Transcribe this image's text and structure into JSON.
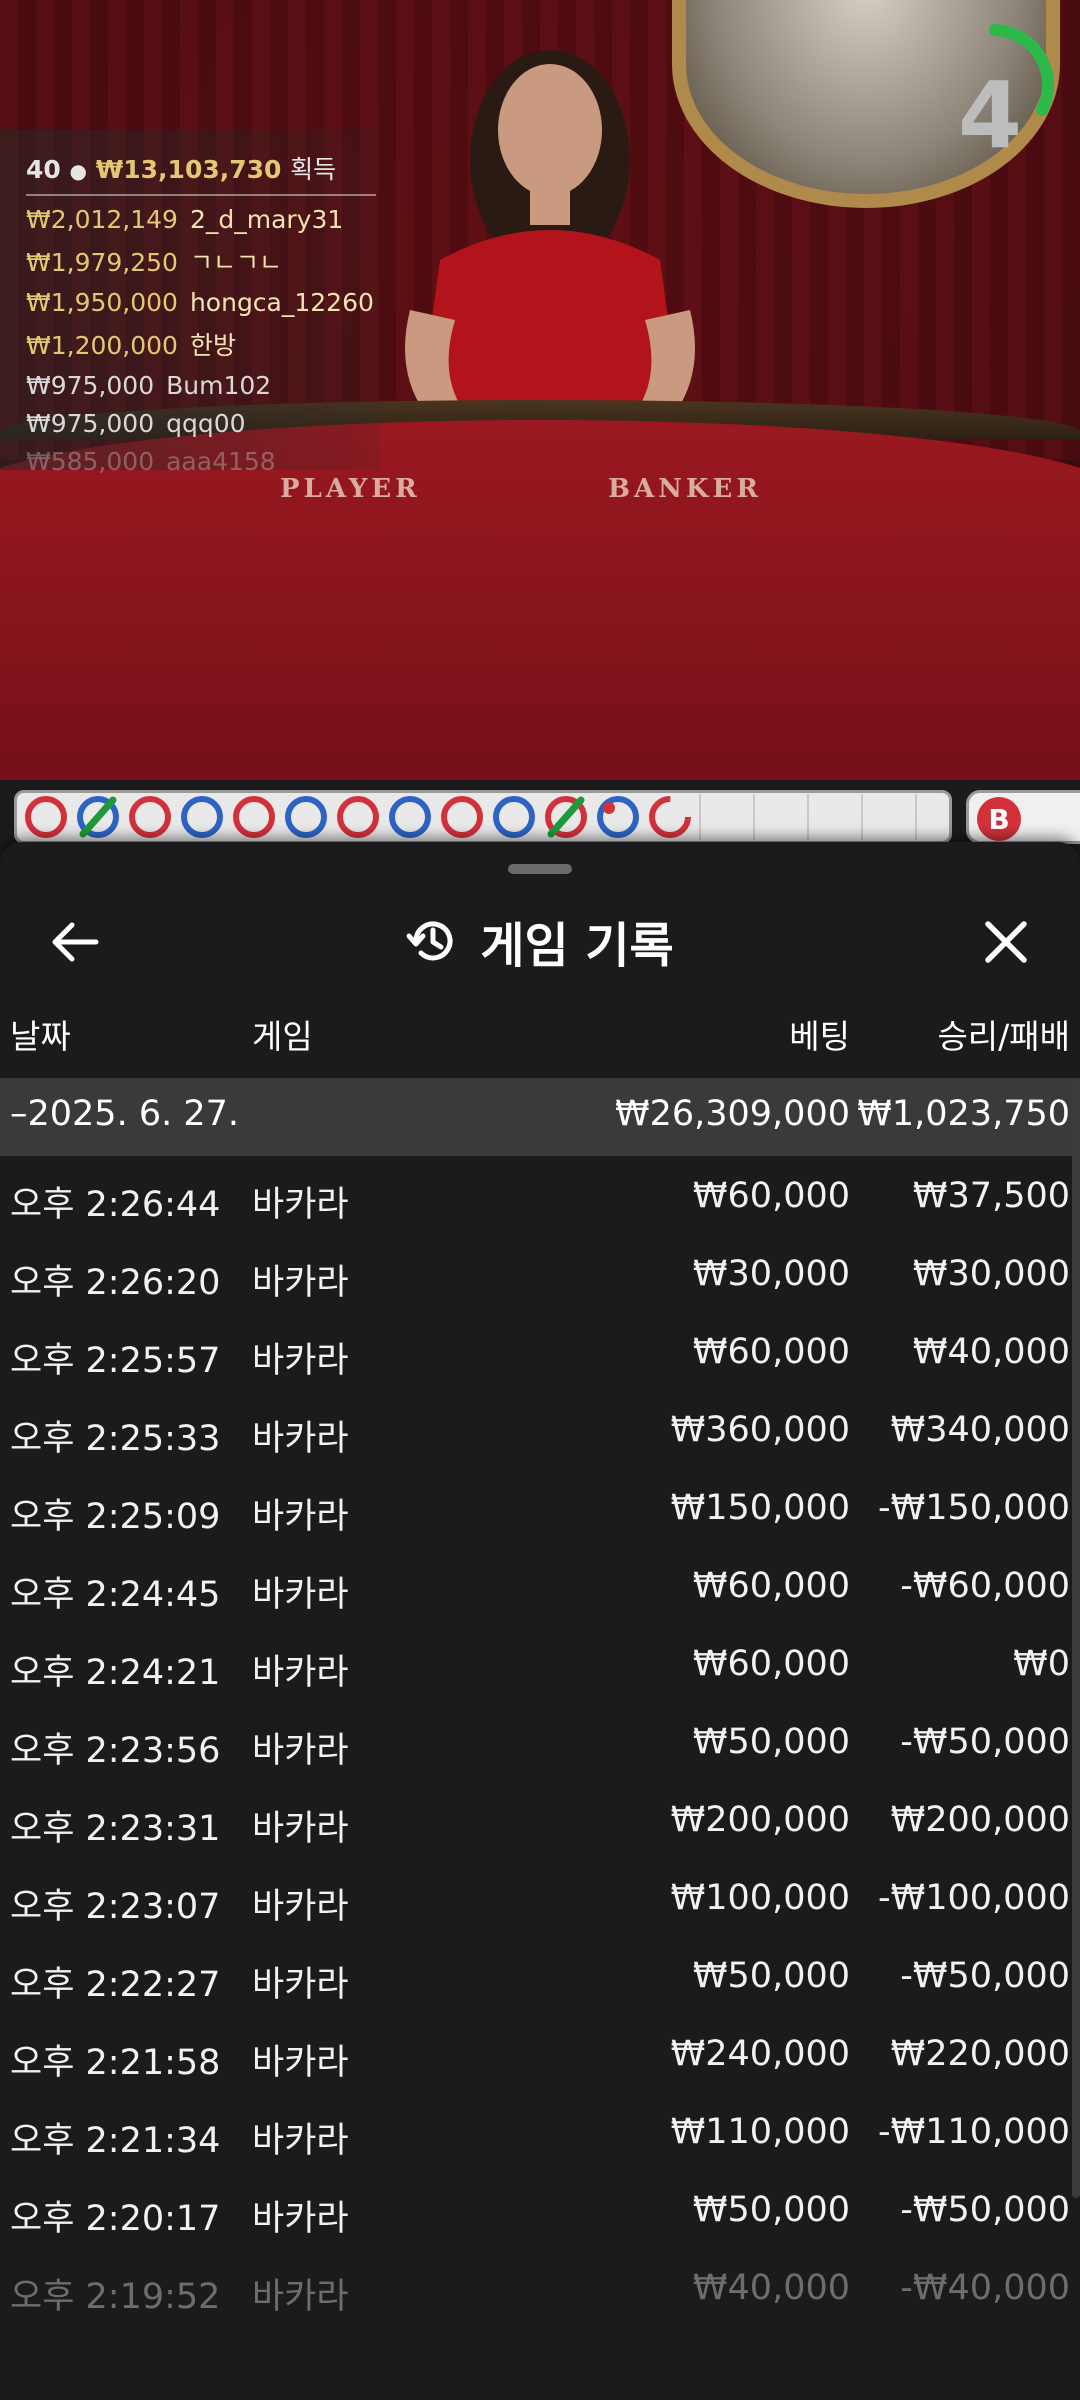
{
  "video": {
    "timer": "4",
    "felt_left": "PLAYER",
    "felt_right": "BANKER",
    "winners": {
      "count": "40",
      "total": "₩13,103,730",
      "suffix": "획득",
      "rows": [
        {
          "amount": "₩2,012,149",
          "name": "2_d_mary31"
        },
        {
          "amount": "₩1,979,250",
          "name": "ㄱㄴㄱㄴ"
        },
        {
          "amount": "₩1,950,000",
          "name": "hongca_12260"
        },
        {
          "amount": "₩1,200,000",
          "name": "한방"
        },
        {
          "amount": "₩975,000",
          "name": "Bum102"
        },
        {
          "amount": "₩975,000",
          "name": "qqq00"
        },
        {
          "amount": "₩585,000",
          "name": "aaa4158"
        }
      ]
    }
  },
  "road": {
    "cells": [
      "red",
      "blue-slash",
      "red",
      "blue",
      "red",
      "blue",
      "red",
      "blue",
      "red",
      "blue",
      "red-slash",
      "blue-dot",
      "red-partial"
    ],
    "side_badge": "B"
  },
  "sheet": {
    "title": "게임 기록",
    "icons": {
      "back": "arrow-left-icon",
      "history": "history-icon",
      "close": "close-icon"
    },
    "columns": {
      "date": "날짜",
      "game": "게임",
      "bet": "베팅",
      "result": "승리/패배"
    },
    "day": {
      "date": "–2025. 6. 27.",
      "bet": "₩26,309,000",
      "result": "₩1,023,750"
    },
    "rows": [
      {
        "time": "오후 2:26:44",
        "game": "바카라",
        "bet": "₩60,000",
        "result": "₩37,500"
      },
      {
        "time": "오후 2:26:20",
        "game": "바카라",
        "bet": "₩30,000",
        "result": "₩30,000"
      },
      {
        "time": "오후 2:25:57",
        "game": "바카라",
        "bet": "₩60,000",
        "result": "₩40,000"
      },
      {
        "time": "오후 2:25:33",
        "game": "바카라",
        "bet": "₩360,000",
        "result": "₩340,000"
      },
      {
        "time": "오후 2:25:09",
        "game": "바카라",
        "bet": "₩150,000",
        "result": "-₩150,000"
      },
      {
        "time": "오후 2:24:45",
        "game": "바카라",
        "bet": "₩60,000",
        "result": "-₩60,000"
      },
      {
        "time": "오후 2:24:21",
        "game": "바카라",
        "bet": "₩60,000",
        "result": "₩0"
      },
      {
        "time": "오후 2:23:56",
        "game": "바카라",
        "bet": "₩50,000",
        "result": "-₩50,000"
      },
      {
        "time": "오후 2:23:31",
        "game": "바카라",
        "bet": "₩200,000",
        "result": "₩200,000"
      },
      {
        "time": "오후 2:23:07",
        "game": "바카라",
        "bet": "₩100,000",
        "result": "-₩100,000"
      },
      {
        "time": "오후 2:22:27",
        "game": "바카라",
        "bet": "₩50,000",
        "result": "-₩50,000"
      },
      {
        "time": "오후 2:21:58",
        "game": "바카라",
        "bet": "₩240,000",
        "result": "₩220,000"
      },
      {
        "time": "오후 2:21:34",
        "game": "바카라",
        "bet": "₩110,000",
        "result": "-₩110,000"
      },
      {
        "time": "오후 2:20:17",
        "game": "바카라",
        "bet": "₩50,000",
        "result": "-₩50,000"
      },
      {
        "time": "오후 2:19:52",
        "game": "바카라",
        "bet": "₩40,000",
        "result": "-₩40,000"
      }
    ]
  }
}
